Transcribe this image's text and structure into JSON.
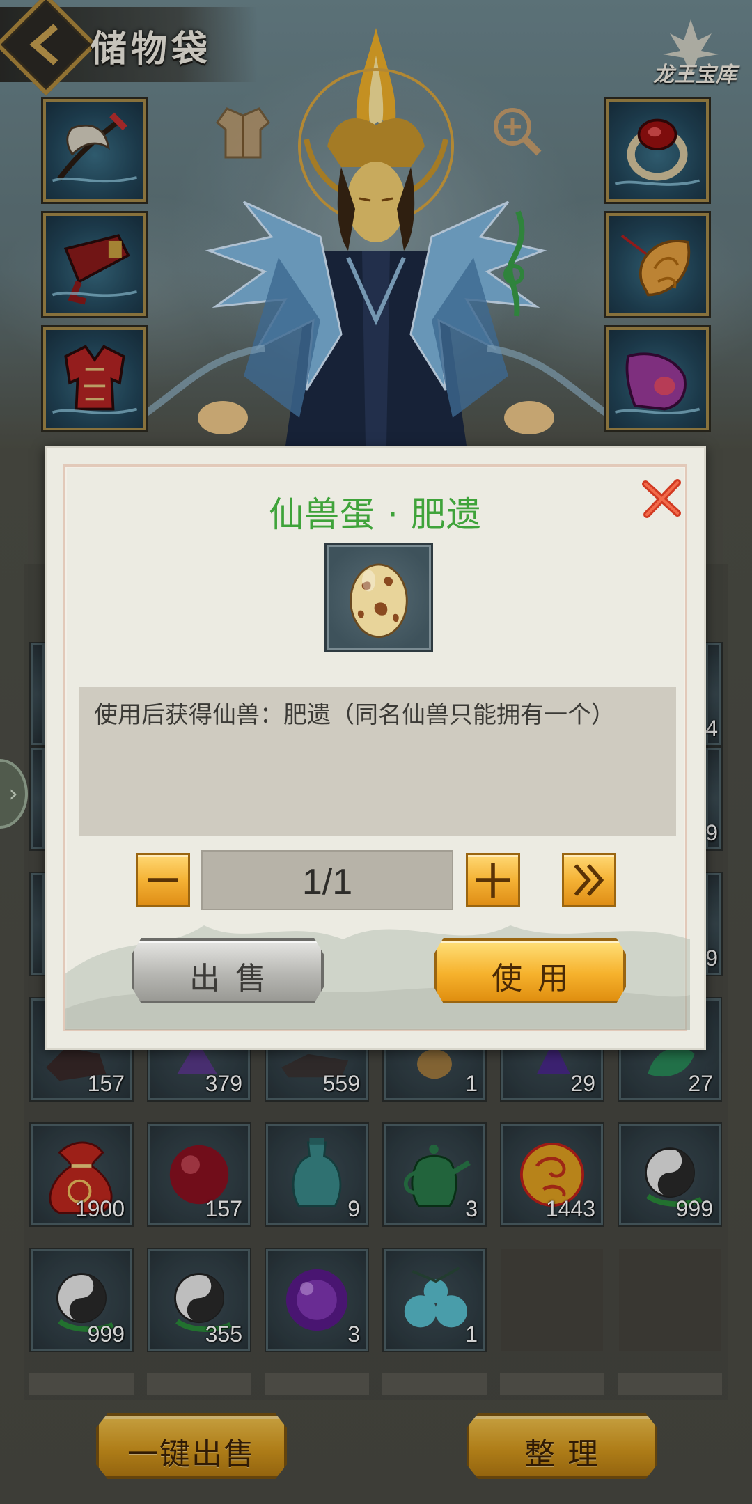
{
  "header": {
    "title": "储物袋",
    "logo_text": "龙王宝库",
    "back_icon": "back-chevron-icon"
  },
  "equipment": {
    "left": [
      "axe-icon",
      "belt-icon",
      "armor-icon"
    ],
    "right": [
      "ring-icon",
      "pendant-icon",
      "boots-icon"
    ],
    "ornaments": [
      "tunic-icon",
      "zoom-icon",
      "jade-hook-icon"
    ]
  },
  "grid": {
    "row_overlap_counts": [
      "157",
      "379",
      "559",
      "1",
      "29",
      "27"
    ],
    "rows": [
      [
        {
          "icon": "lucky-bag-icon",
          "count": "1900"
        },
        {
          "icon": "red-orb-icon",
          "count": "157"
        },
        {
          "icon": "jade-jar-icon",
          "count": "9"
        },
        {
          "icon": "teapot-icon",
          "count": "3"
        },
        {
          "icon": "golden-orb-icon",
          "count": "1443"
        },
        {
          "icon": "yinyang-gourd-icon",
          "count": "999"
        }
      ],
      [
        {
          "icon": "yinyang-gourd-icon",
          "count": "999"
        },
        {
          "icon": "yinyang-gourd-icon",
          "count": "355"
        },
        {
          "icon": "purple-orb-icon",
          "count": "3"
        },
        {
          "icon": "spirit-fruit-icon",
          "count": "1"
        },
        {
          "icon": "",
          "count": ""
        },
        {
          "icon": "",
          "count": ""
        }
      ]
    ],
    "right_edge_counts": [
      "4",
      "9",
      "9"
    ]
  },
  "bottom": {
    "sell_all": "一键出售",
    "sort": "整 理"
  },
  "modal": {
    "title": "仙兽蛋 · 肥遗",
    "item_icon": "spotted-egg-icon",
    "description": "使用后获得仙兽：肥遗（同名仙兽只能拥有一个）",
    "quantity": "1/1",
    "sell_label": "出售",
    "use_label": "使用",
    "close_icon": "close-icon"
  },
  "colors": {
    "title_green": "#3fa33a",
    "gold": "#f4b235",
    "frame_gold": "#a58a4a"
  }
}
